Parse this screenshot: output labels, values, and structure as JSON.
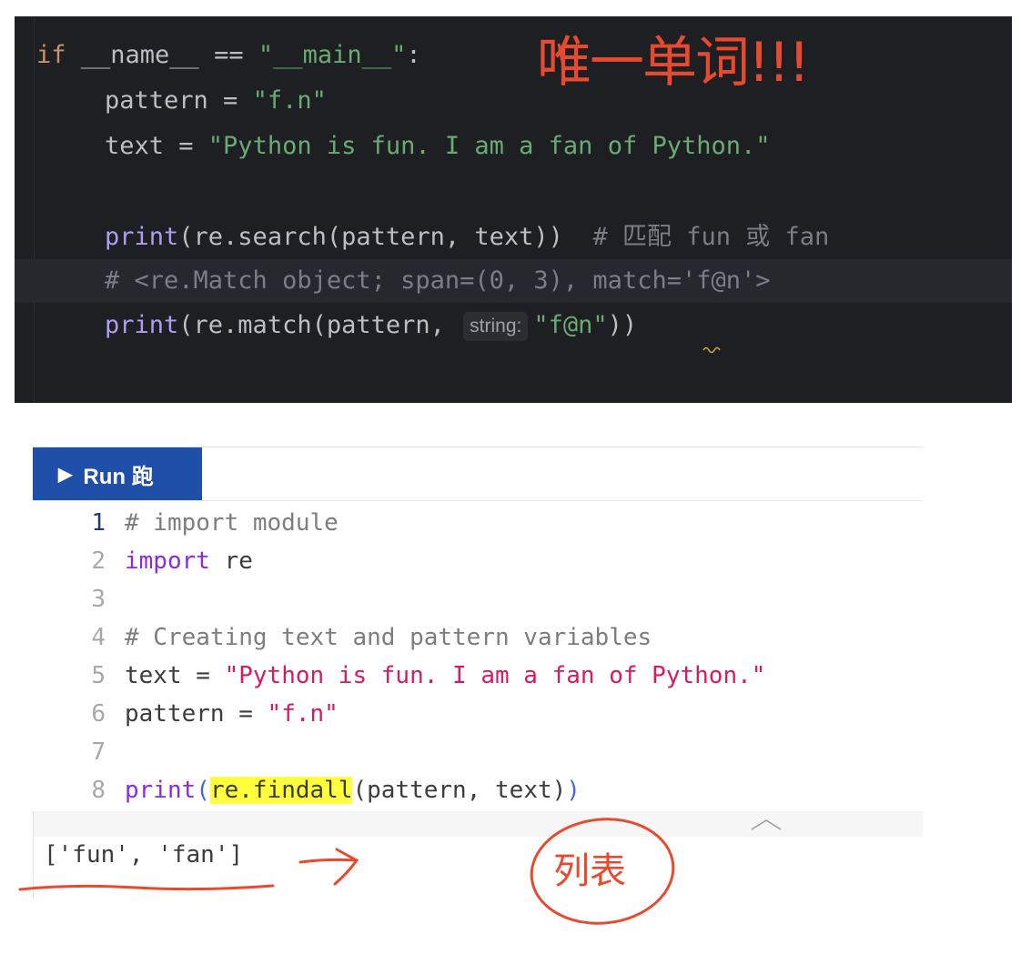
{
  "ide": {
    "lines": [
      {
        "parts": [
          "if",
          " __name__ == ",
          "\"__main__\"",
          ":"
        ]
      },
      {
        "parts": [
          "pattern = ",
          "\"f.n\""
        ]
      },
      {
        "parts": [
          "text = ",
          "\"Python is fun. I am a fan of Python.\""
        ]
      },
      {
        "parts": [
          "print",
          "(re.search(pattern, text))  ",
          "# 匹配 fun 或 fan"
        ]
      },
      {
        "parts": [
          "# <re.Match object; span=(0, 3), match='f@n'>"
        ]
      },
      {
        "parts": [
          "print",
          "(re.match(pattern, ",
          "string:",
          "\"f@n\"",
          "))"
        ]
      }
    ]
  },
  "runner": {
    "run_label": "Run 跑",
    "code_lines": [
      {
        "num": "1",
        "text": "# import module"
      },
      {
        "num": "2",
        "kw": "import",
        "rest": " re"
      },
      {
        "num": "3",
        "text": ""
      },
      {
        "num": "4",
        "text": "# Creating text and pattern variables"
      },
      {
        "num": "5",
        "pre": "text = ",
        "str": "\"Python is fun. I am a fan of Python.\""
      },
      {
        "num": "6",
        "pre": "pattern = ",
        "str": "\"f.n\""
      },
      {
        "num": "7",
        "text": ""
      },
      {
        "num": "8",
        "fn": "print",
        "p1": "(",
        "hl": "re.findall",
        "mid": "(pattern, text)",
        "p2": ")"
      }
    ],
    "output": "['fun', 'fan']"
  },
  "annotations": {
    "top_note": "唯一单词!!!",
    "list_note": "列表"
  },
  "colors": {
    "ide_bg": "#1e1f22",
    "run_button": "#1f4fa8",
    "annotation_red": "#e84a2f",
    "highlight_yellow": "#ffff3e"
  }
}
